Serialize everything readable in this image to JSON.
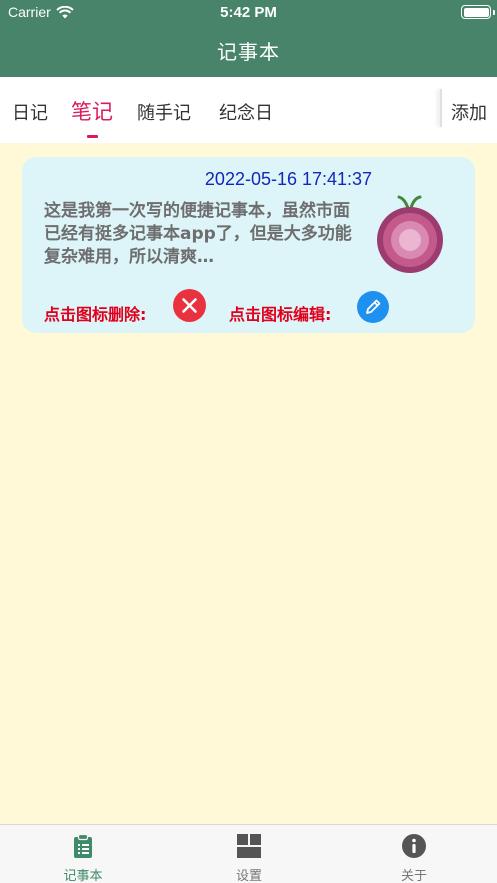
{
  "status_bar": {
    "carrier": "Carrier",
    "time": "5:42 PM"
  },
  "nav": {
    "title": "记事本"
  },
  "tabs": [
    {
      "label": "日记"
    },
    {
      "label": "笔记",
      "active": true
    },
    {
      "label": "随手记"
    },
    {
      "label": "纪念日"
    }
  ],
  "add_label": "添加",
  "note": {
    "date": "2022-05-16 17:41:37",
    "text": "这是我第一次写的便捷记事本，虽然市面已经有挺多记事本app了，但是大多功能复杂难用，所以清爽…",
    "delete_label": "点击图标删除:",
    "edit_label": "点击图标编辑:"
  },
  "bottom_tabs": [
    {
      "label": "记事本",
      "icon": "clipboard-icon",
      "active": true
    },
    {
      "label": "设置",
      "icon": "grid-icon"
    },
    {
      "label": "关于",
      "icon": "info-icon"
    }
  ],
  "colors": {
    "header": "#47846a",
    "accent": "#d81b60",
    "content_bg": "#fff9d8",
    "card_bg": "#ddf5f8",
    "date_text": "#1328b8",
    "action_label": "#e0001b",
    "delete_button": "#e8323f",
    "edit_button": "#1e90f0"
  }
}
